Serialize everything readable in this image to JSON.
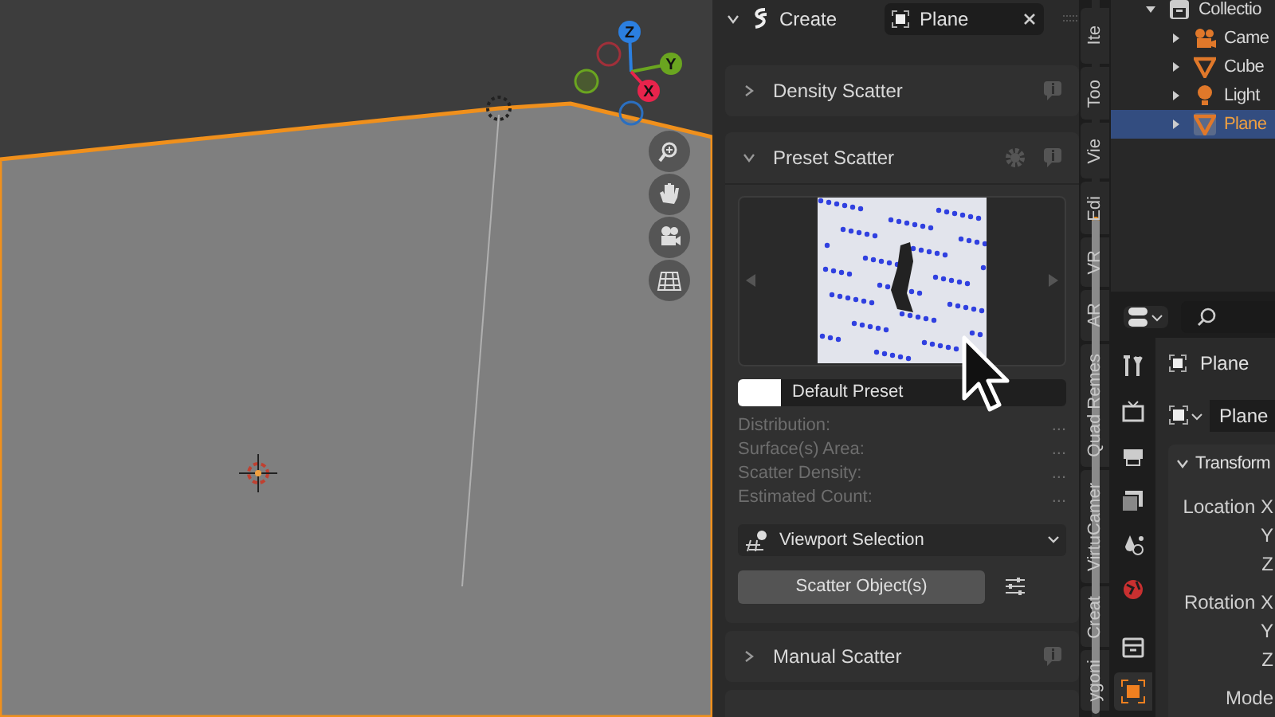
{
  "viewport": {
    "gizmo": [
      {
        "label": "Z",
        "kind": "z"
      },
      {
        "label": "Y",
        "kind": "y"
      },
      {
        "label": "X",
        "kind": "x"
      }
    ],
    "nav_buttons": [
      {
        "kind": "zoom"
      },
      {
        "kind": "pan"
      },
      {
        "kind": "camera"
      },
      {
        "kind": "grid"
      }
    ]
  },
  "sidebar": {
    "header": {
      "label": "Create",
      "object": "Plane"
    },
    "panels": [
      {
        "title": "Density Scatter",
        "expanded": false
      },
      {
        "title": "Preset Scatter",
        "expanded": true,
        "preset_name": "Default Preset",
        "stats": [
          {
            "label": "Distribution:",
            "value": "..."
          },
          {
            "label": "Surface(s) Area:",
            "value": "..."
          },
          {
            "label": "Scatter Density:",
            "value": "..."
          },
          {
            "label": "Estimated Count:",
            "value": "..."
          }
        ],
        "selection_mode": "Viewport Selection",
        "action": "Scatter Object(s)"
      },
      {
        "title": "Manual Scatter",
        "expanded": false
      }
    ]
  },
  "tabs": [
    {
      "label": "Ite"
    },
    {
      "label": "Too"
    },
    {
      "label": "Vie"
    },
    {
      "label": "Edi"
    },
    {
      "label": "VR"
    },
    {
      "label": "AR"
    },
    {
      "label": "Quad Remes"
    },
    {
      "label": "VirtuCamer"
    },
    {
      "label": "Creat"
    },
    {
      "label": "ygoni"
    }
  ],
  "outliner": {
    "items": [
      {
        "label": "Collectio",
        "kind": "collection",
        "selected": false,
        "children": [
          {
            "label": "Came",
            "kind": "camera",
            "selected": false
          },
          {
            "label": "Cube",
            "kind": "mesh",
            "selected": false
          },
          {
            "label": "Light",
            "kind": "light",
            "selected": false
          },
          {
            "label": "Plane",
            "kind": "mesh",
            "selected": true
          }
        ]
      }
    ]
  },
  "properties": {
    "tabs": [
      {
        "kind": "tool",
        "selected": false
      },
      {
        "kind": "render",
        "selected": false
      },
      {
        "kind": "output",
        "selected": false
      },
      {
        "kind": "view_layer",
        "selected": false
      },
      {
        "kind": "scene",
        "selected": false
      },
      {
        "kind": "world",
        "selected": false
      },
      {
        "kind": "collection",
        "selected": false
      },
      {
        "kind": "object",
        "selected": true
      }
    ],
    "object_name": "Plane",
    "datablock": "Plane",
    "section": "Transform",
    "fields": [
      {
        "label": "Location X"
      },
      {
        "label": "Y"
      },
      {
        "label": "Z"
      },
      {
        "label": "Rotation X"
      },
      {
        "label": "Y"
      },
      {
        "label": "Z"
      },
      {
        "label": "Mode"
      }
    ]
  }
}
